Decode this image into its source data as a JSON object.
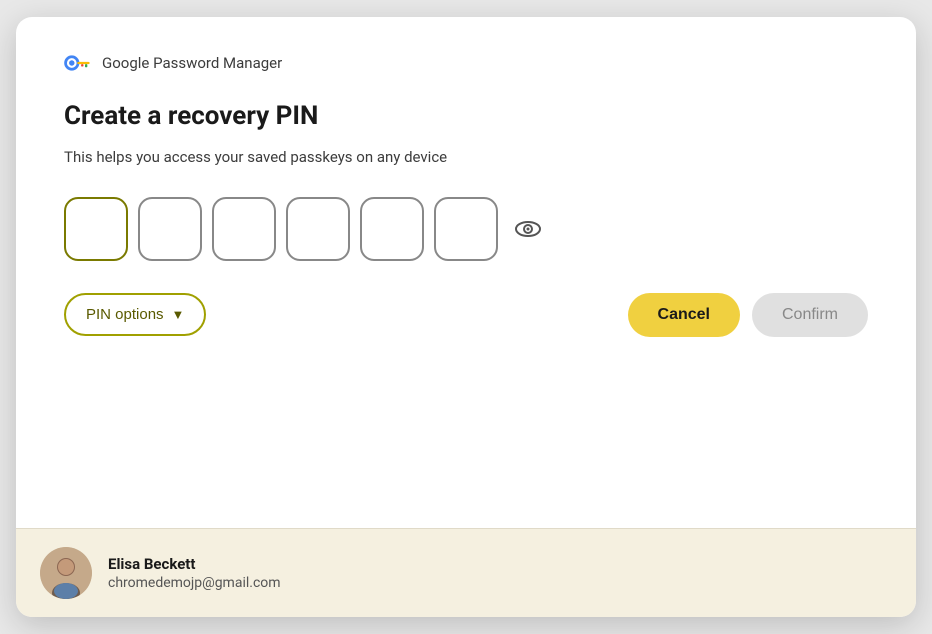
{
  "header": {
    "app_name": "Google Password Manager"
  },
  "dialog": {
    "title": "Create a recovery PIN",
    "description": "This helps you access your saved passkeys on any device",
    "pin_boxes": [
      {
        "id": "pin1",
        "value": "",
        "placeholder": ""
      },
      {
        "id": "pin2",
        "value": "",
        "placeholder": ""
      },
      {
        "id": "pin3",
        "value": "",
        "placeholder": ""
      },
      {
        "id": "pin4",
        "value": "",
        "placeholder": ""
      },
      {
        "id": "pin5",
        "value": "",
        "placeholder": ""
      },
      {
        "id": "pin6",
        "value": "",
        "placeholder": ""
      }
    ],
    "eye_icon_label": "toggle-visibility-icon",
    "actions": {
      "pin_options_label": "PIN options",
      "cancel_label": "Cancel",
      "confirm_label": "Confirm"
    }
  },
  "footer": {
    "user_name": "Elisa Beckett",
    "user_email": "chromedemojp@gmail.com"
  }
}
